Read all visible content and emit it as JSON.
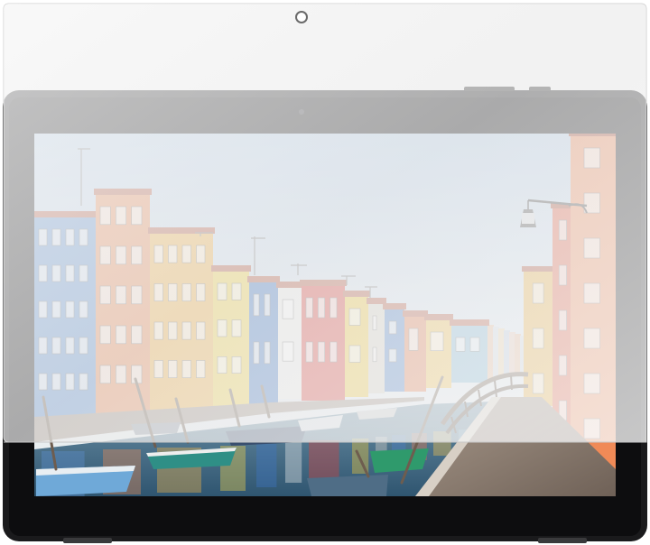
{
  "image": {
    "subject": "tablet-with-screen-protector",
    "colors": {
      "tablet_body": "#1a1a1c",
      "bezel": "#0d0d0f",
      "sky": "#c9dcef",
      "water": "#3e6a86",
      "walkway": "#8b7d72",
      "protector_film": "#e6e6e6"
    },
    "houses_left": [
      {
        "color": "#5c8fcf"
      },
      {
        "color": "#e88a54"
      },
      {
        "color": "#f1b247"
      },
      {
        "color": "#f2d34a"
      },
      {
        "color": "#3f76c4"
      },
      {
        "color": "#ededeb"
      },
      {
        "color": "#d9403a"
      },
      {
        "color": "#f0c83a"
      },
      {
        "color": "#d8d2c8"
      },
      {
        "color": "#4a7fc8"
      },
      {
        "color": "#e27a4d"
      },
      {
        "color": "#f2c04f"
      },
      {
        "color": "#7fb7d6"
      }
    ],
    "houses_right": [
      {
        "color": "#e8ad3c"
      },
      {
        "color": "#e15c3f"
      },
      {
        "color": "#f08a57"
      }
    ]
  }
}
